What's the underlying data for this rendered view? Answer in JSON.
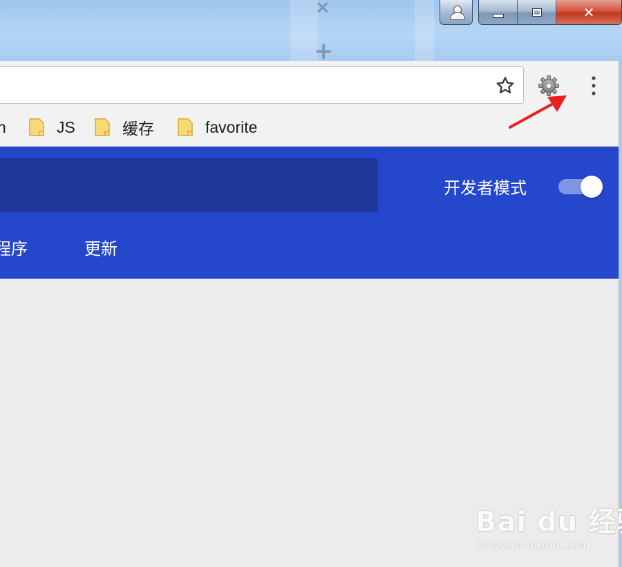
{
  "window": {
    "close_glyph": "✕",
    "background_plus": "+",
    "background_x": "×"
  },
  "toolbar": {
    "omnibox_value": "",
    "icons": [
      "star-icon",
      "gear-icon",
      "kebab-menu-icon"
    ]
  },
  "bookmarks": {
    "items": [
      {
        "label": "n",
        "icon": "folder-icon"
      },
      {
        "label": "JS",
        "icon": "folder-icon"
      },
      {
        "label": "缓存",
        "icon": "folder-icon"
      },
      {
        "label": "favorite",
        "icon": "folder-icon"
      }
    ]
  },
  "extensions_header": {
    "search_value": "",
    "developer_mode_label": "开发者模式",
    "developer_mode_on": true,
    "tabs": [
      "程序",
      "更新"
    ]
  },
  "watermark": {
    "logo": "Bai du 经验",
    "url": "jingyan.baidu.com"
  },
  "colors": {
    "header_blue": "#2447cc",
    "search_blue": "#1e3799",
    "toggle_track": "#7f96e6",
    "annotation_red": "#e8201f",
    "folder_yellow": "#f8d978"
  }
}
